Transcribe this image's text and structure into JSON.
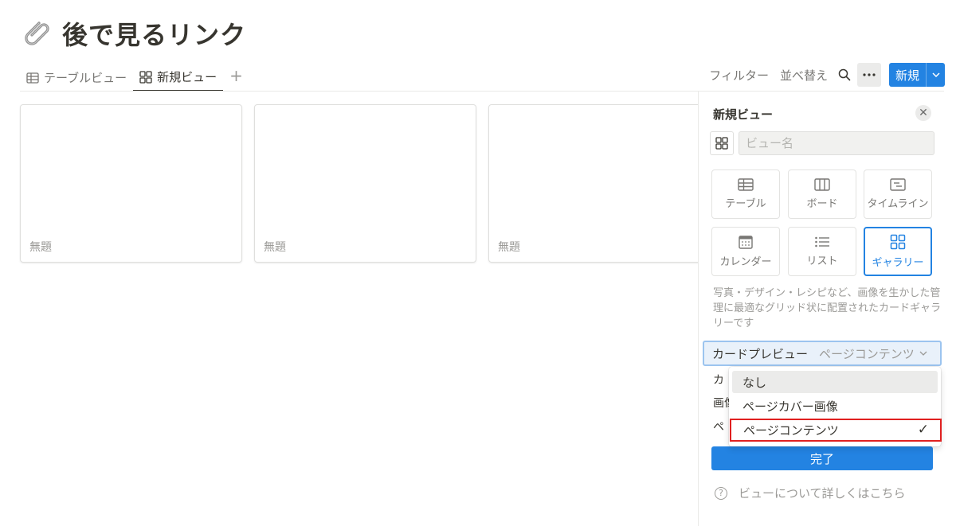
{
  "page": {
    "title": "後で見るリンク",
    "icon": "paperclip-icon"
  },
  "tabs": [
    {
      "label": "テーブルビュー",
      "icon": "table-icon",
      "active": false
    },
    {
      "label": "新規ビュー",
      "icon": "gallery-icon",
      "active": true
    }
  ],
  "toolbar": {
    "filter_label": "フィルター",
    "sort_label": "並べ替え",
    "new_label": "新規"
  },
  "cards": [
    {
      "title": "無題"
    },
    {
      "title": "無題"
    },
    {
      "title": "無題"
    }
  ],
  "side_panel": {
    "title": "新規ビュー",
    "name_placeholder": "ビュー名",
    "view_types": [
      {
        "label": "テーブル",
        "icon": "table-icon",
        "selected": false
      },
      {
        "label": "ボード",
        "icon": "board-icon",
        "selected": false
      },
      {
        "label": "タイムライン",
        "icon": "timeline-icon",
        "selected": false
      },
      {
        "label": "カレンダー",
        "icon": "calendar-icon",
        "selected": false
      },
      {
        "label": "リスト",
        "icon": "list-icon",
        "selected": false
      },
      {
        "label": "ギャラリー",
        "icon": "gallery-icon",
        "selected": true
      }
    ],
    "description": "写真・デザイン・レシピなど、画像を生かした管理に最適なグリッド状に配置されたカードギャラリーです",
    "card_preview_label": "カードプレビュー",
    "card_preview_value": "ページコンテンツ",
    "row_partial_1": "カ",
    "row_partial_2": "画像",
    "row_partial_3": "ペ",
    "done_label": "完了",
    "help_text": "ビューについて詳しくはこちら"
  },
  "dropdown": {
    "options": [
      {
        "label": "なし",
        "hover": true,
        "selected": false
      },
      {
        "label": "ページカバー画像",
        "hover": false,
        "selected": false
      },
      {
        "label": "ページコンテンツ",
        "hover": false,
        "selected": true
      }
    ],
    "check_mark": "✓"
  },
  "colors": {
    "accent": "#2383e2",
    "text": "#37352f",
    "muted": "#9b9a97",
    "highlight_outline": "#e02020"
  }
}
